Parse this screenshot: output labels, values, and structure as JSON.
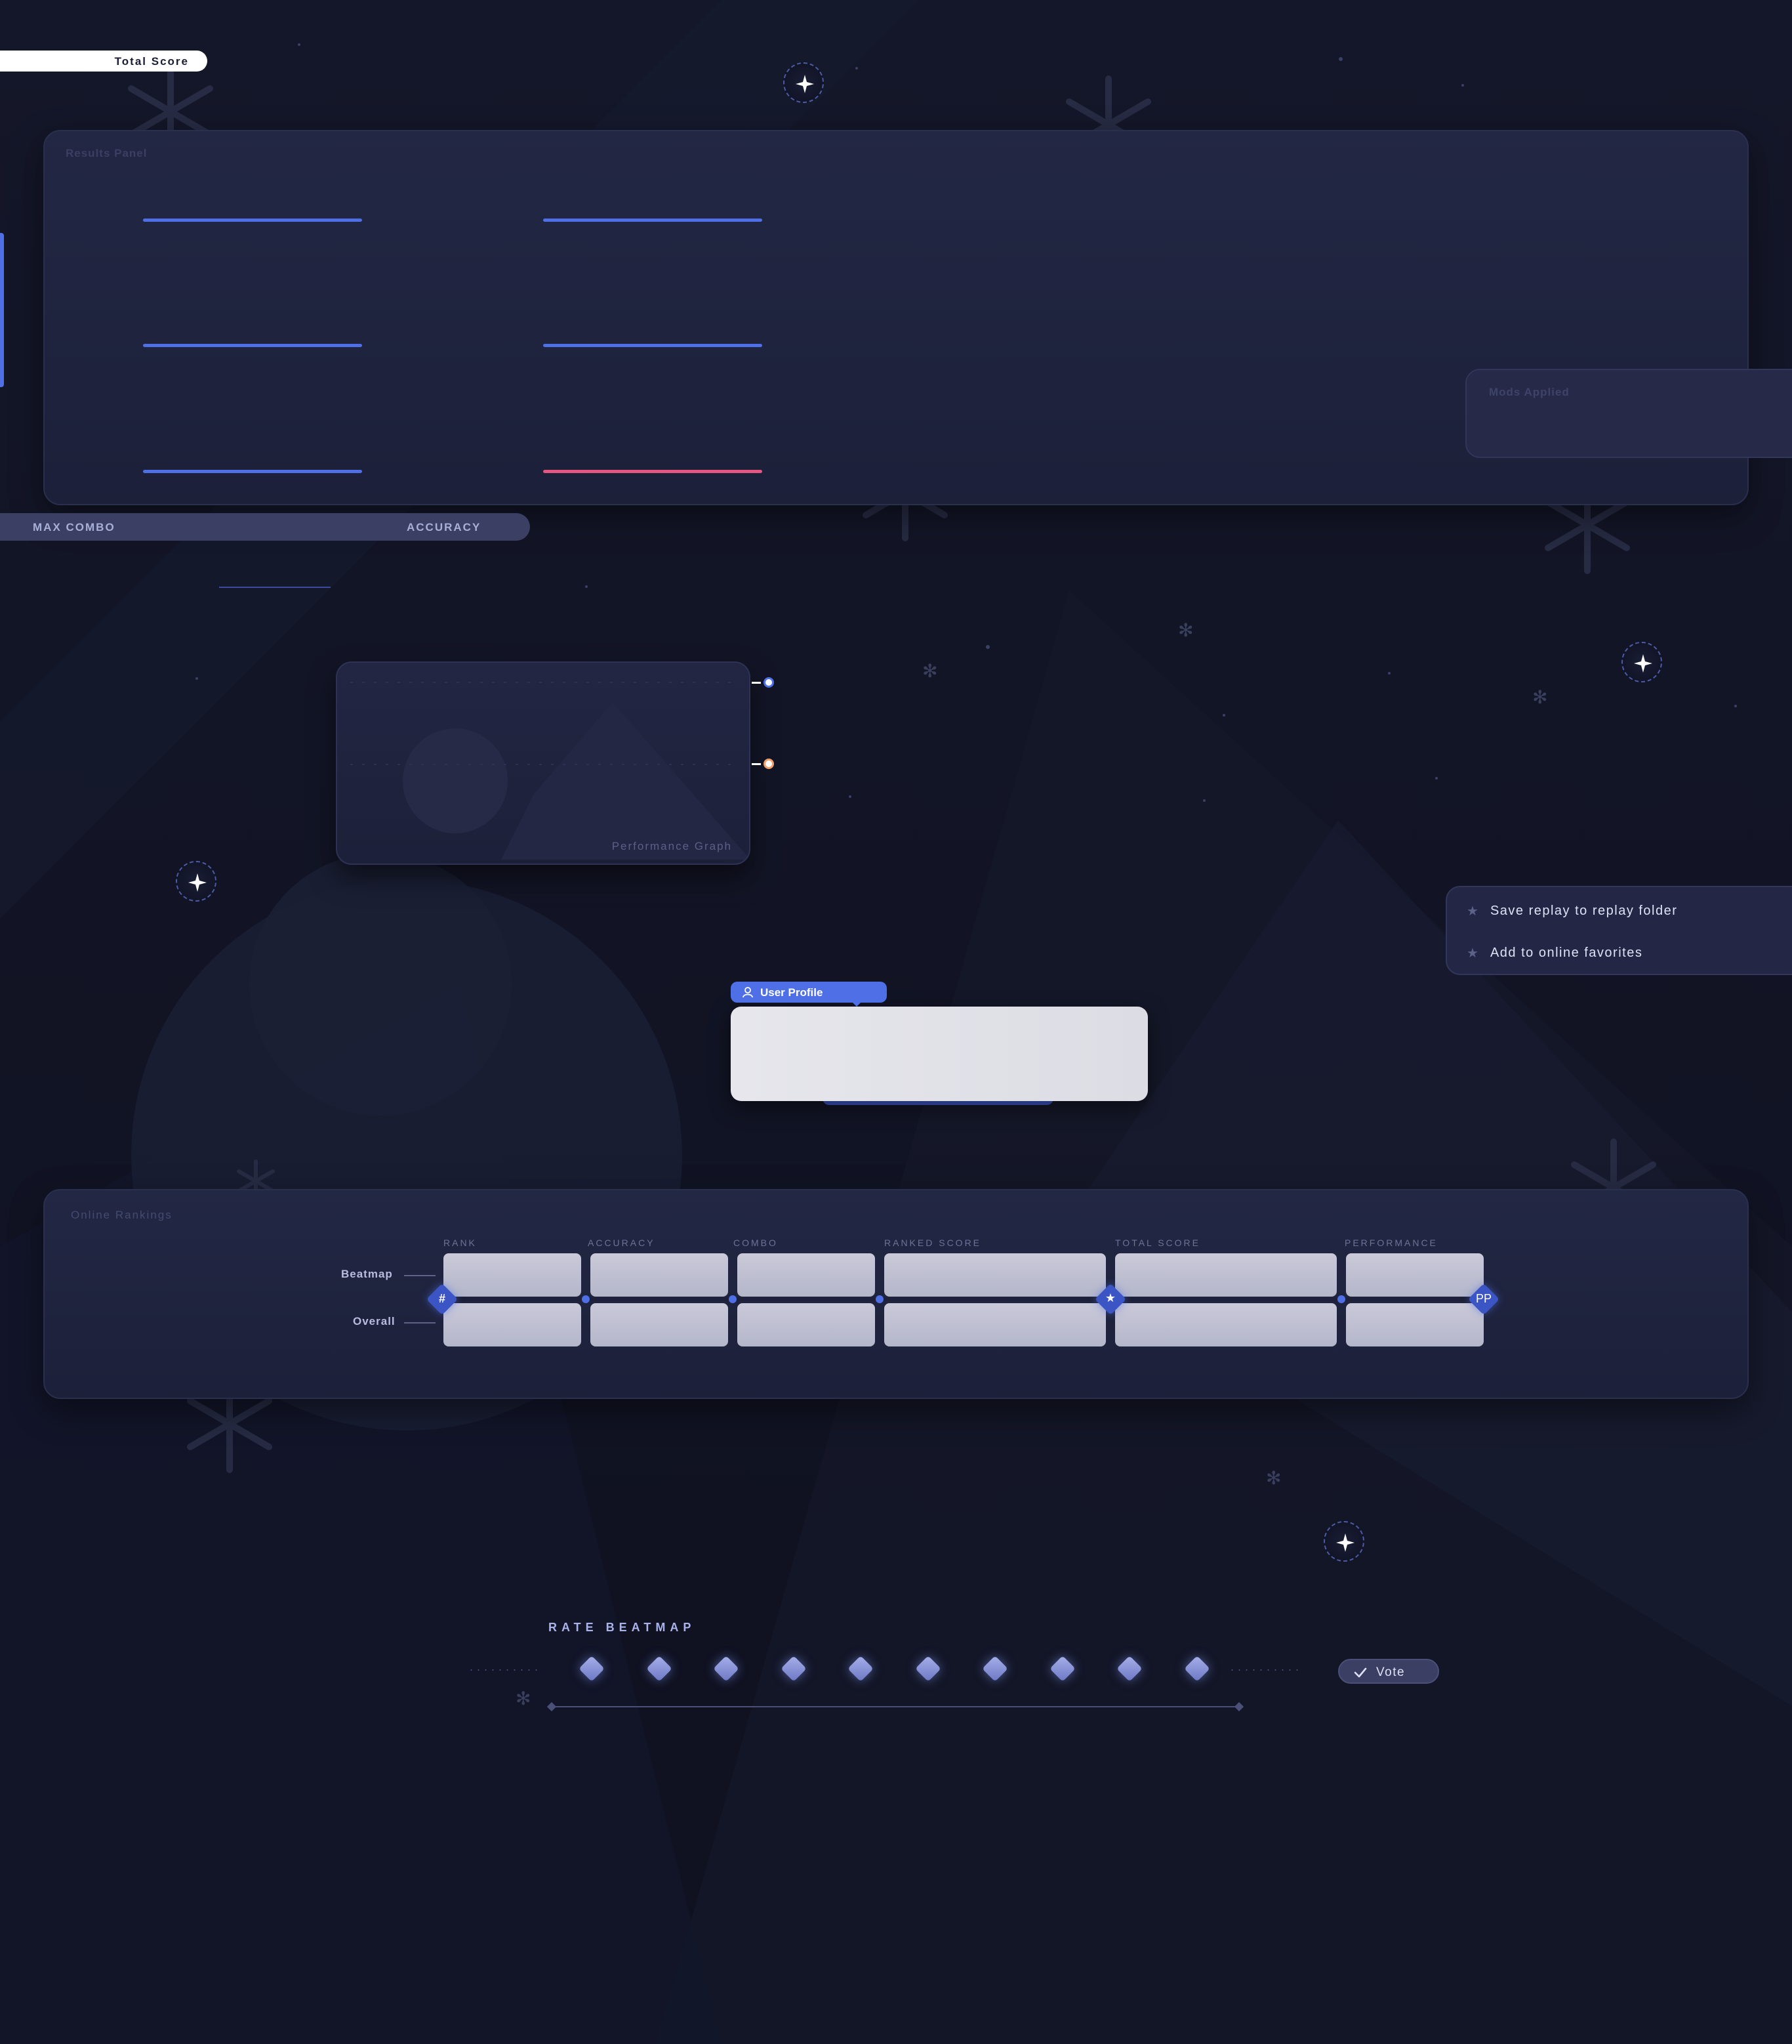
{
  "colors": {
    "background": "#10121f",
    "panel": "#1f2340",
    "accent_blue": "#4f6fe6",
    "accent_red": "#e5557f",
    "accent_orange": "#f1a06a"
  },
  "header": {
    "total_score_label": "Total Score"
  },
  "results_panel": {
    "title": "Results Panel",
    "lines": [
      {
        "color": "blue"
      },
      {
        "color": "blue"
      },
      {
        "color": "blue"
      },
      {
        "color": "blue"
      },
      {
        "color": "blue"
      },
      {
        "color": "red"
      }
    ]
  },
  "stats_strip": {
    "max_combo_label": "MAX COMBO",
    "accuracy_label": "ACCURACY"
  },
  "mods": {
    "title": "Mods Applied"
  },
  "performance_graph": {
    "title": "Performance Graph"
  },
  "context_menu": {
    "items": [
      {
        "icon": "star-icon",
        "label": "Save replay to replay folder"
      },
      {
        "icon": "star-icon",
        "label": "Add to online favorites"
      }
    ]
  },
  "user_profile": {
    "tag_label": "User Profile",
    "icon": "user-icon"
  },
  "rankings": {
    "title": "Online Rankings",
    "columns": [
      "RANK",
      "ACCURACY",
      "COMBO",
      "RANKED SCORE",
      "TOTAL SCORE",
      "PERFORMANCE"
    ],
    "rows": [
      "Beatmap",
      "Overall"
    ],
    "nodes": {
      "start": "#",
      "middle": "star-icon",
      "end": "PP"
    }
  },
  "rate_beatmap": {
    "title": "RATE BEATMAP",
    "scale_max": 10,
    "vote_label": "Vote",
    "vote_icon": "check-icon"
  }
}
